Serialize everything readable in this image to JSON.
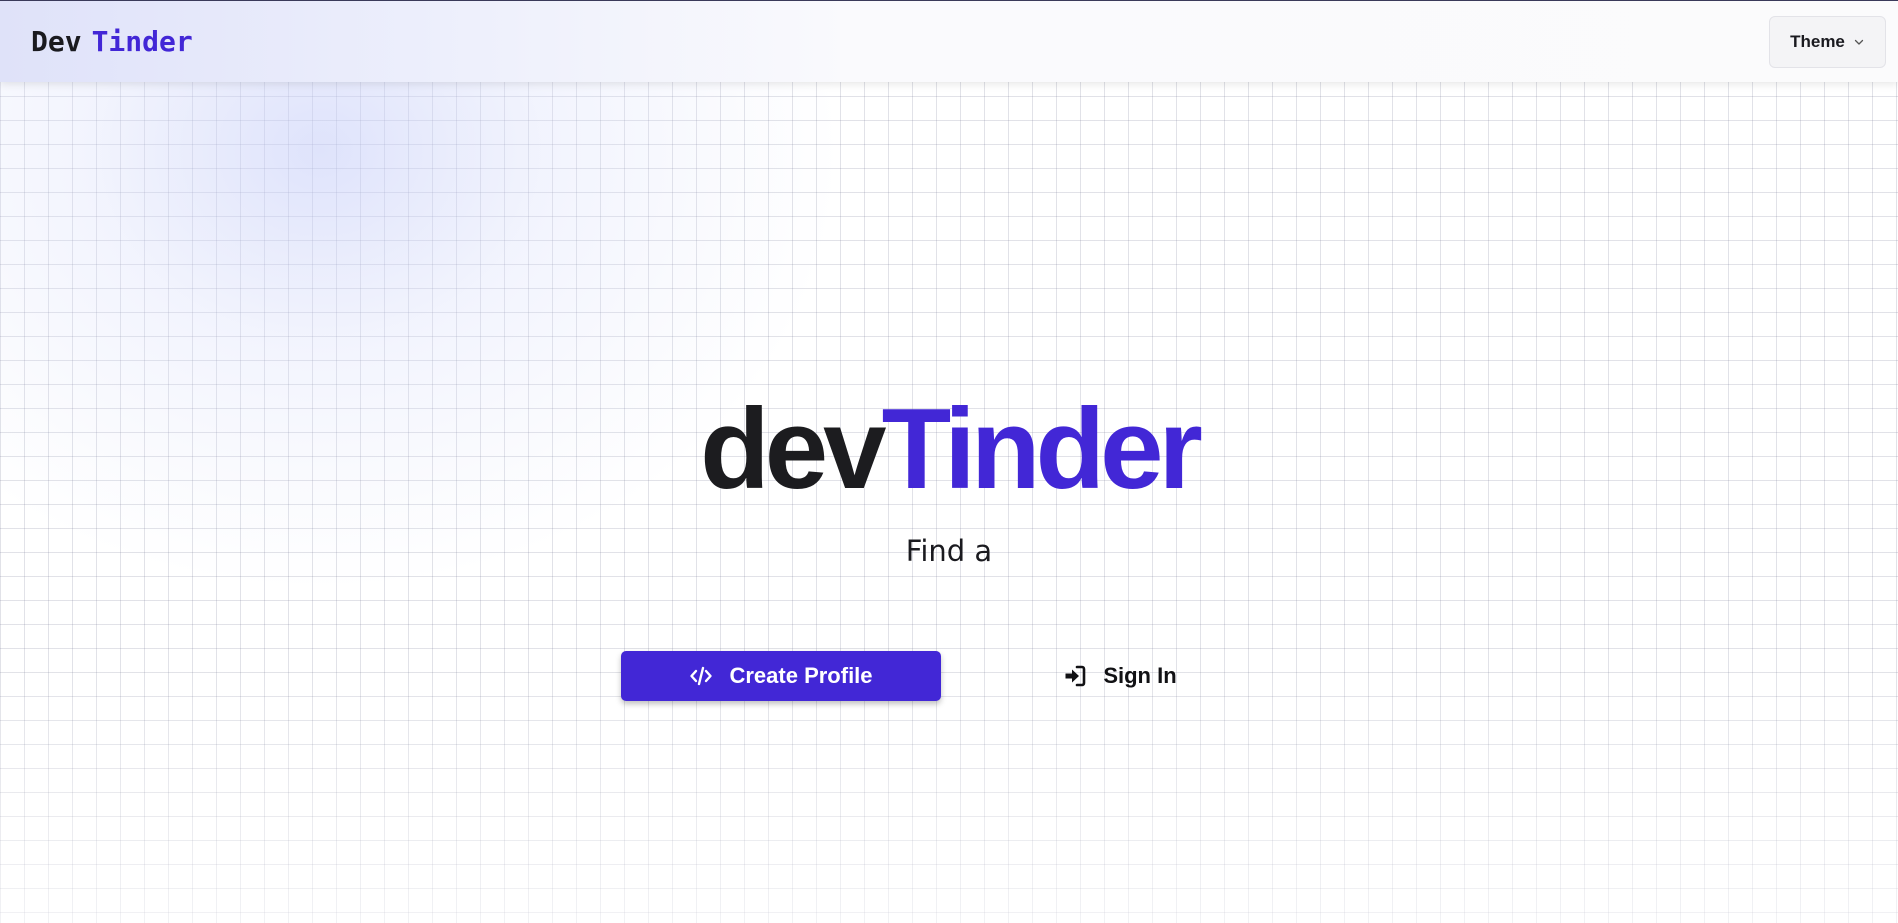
{
  "navbar": {
    "brand_first": "Dev",
    "brand_second": "Tinder",
    "theme_label": "Theme",
    "theme_icon": "chevron-down-icon"
  },
  "hero": {
    "title_first": "dev",
    "title_second": "Tinder",
    "subtitle": "Find a"
  },
  "actions": {
    "create_label": "Create Profile",
    "create_icon": "code-icon",
    "signin_label": "Sign In",
    "signin_icon": "sign-in-icon"
  },
  "colors": {
    "accent": "#4227d6",
    "text": "#1c1c1f"
  }
}
